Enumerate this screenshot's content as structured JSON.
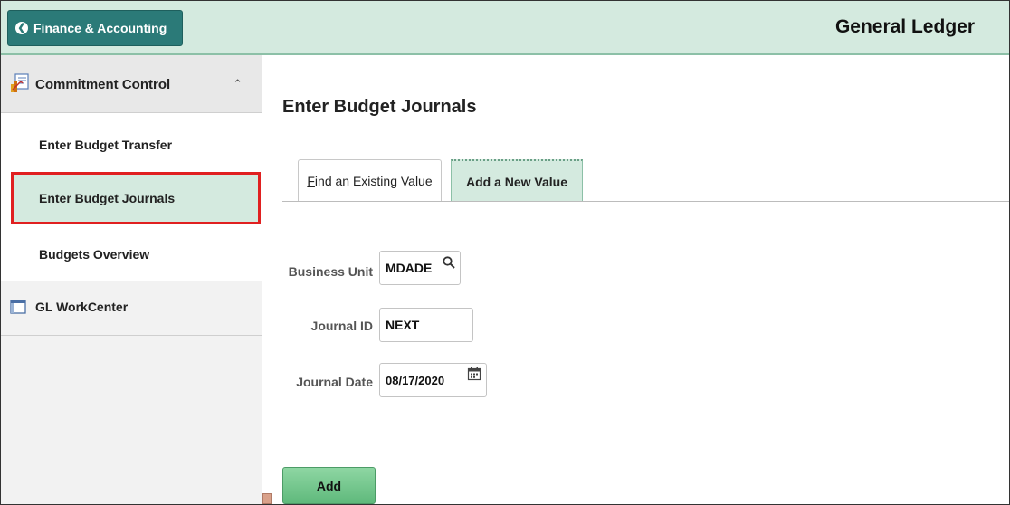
{
  "header": {
    "back_label": "Finance & Accounting",
    "title": "General Ledger",
    "accent_color": "#2b7a78",
    "banner_color": "#d4eadf"
  },
  "sidebar": {
    "section": {
      "label": "Commitment Control",
      "icon": "commitment-control-icon",
      "expanded": true
    },
    "items": [
      {
        "label": "Enter Budget Transfer"
      },
      {
        "label": "Enter Budget Journals",
        "selected": true
      },
      {
        "label": "Budgets Overview"
      }
    ],
    "workcenter": {
      "label": "GL WorkCenter",
      "icon": "workcenter-icon"
    }
  },
  "main": {
    "page_title": "Enter Budget Journals",
    "tabs": [
      {
        "label": "Find an Existing Value",
        "active": false
      },
      {
        "label": "Add a New Value",
        "active": true
      }
    ],
    "fields": {
      "business_unit": {
        "label": "Business Unit",
        "value": "MDADE"
      },
      "journal_id": {
        "label": "Journal ID",
        "value": "NEXT"
      },
      "journal_date": {
        "label": "Journal Date",
        "value": "08/17/2020"
      }
    },
    "add_button": "Add"
  },
  "highlight_color": "#e02020"
}
